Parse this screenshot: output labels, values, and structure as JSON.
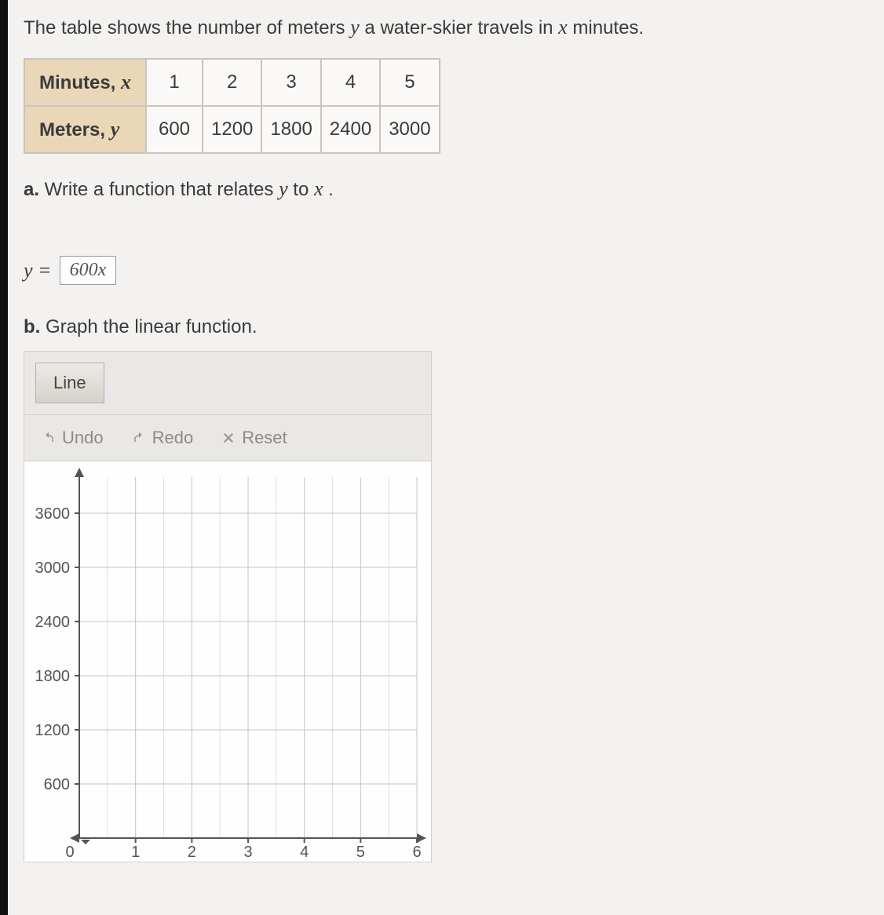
{
  "question": {
    "intro_pre": "The table shows the number of meters ",
    "intro_mid": " a water-skier travels in ",
    "intro_post": " minutes.",
    "var_y": "y",
    "var_x": "x"
  },
  "table": {
    "row1_label_pre": "Minutes, ",
    "row1_var": "x",
    "row2_label_pre": "Meters, ",
    "row2_var": "y",
    "cols": [
      "1",
      "2",
      "3",
      "4",
      "5"
    ],
    "vals": [
      "600",
      "1200",
      "1800",
      "2400",
      "3000"
    ]
  },
  "part_a": {
    "label": "a.",
    "text_pre": " Write a function that relates ",
    "text_mid": " to ",
    "text_post": " .",
    "answer_lhs": "y =",
    "answer_box": "600x"
  },
  "part_b": {
    "label": "b.",
    "text": " Graph the linear function."
  },
  "widget": {
    "line_tool": "Line",
    "undo": "Undo",
    "redo": "Redo",
    "reset": "Reset"
  },
  "chart_data": {
    "type": "line",
    "x_ticks": [
      "0",
      "1",
      "2",
      "3",
      "4",
      "5",
      "6"
    ],
    "y_ticks": [
      "600",
      "1200",
      "1800",
      "2400",
      "3000",
      "3600"
    ],
    "xlim": [
      0,
      6
    ],
    "ylim": [
      0,
      4000
    ],
    "series": []
  }
}
